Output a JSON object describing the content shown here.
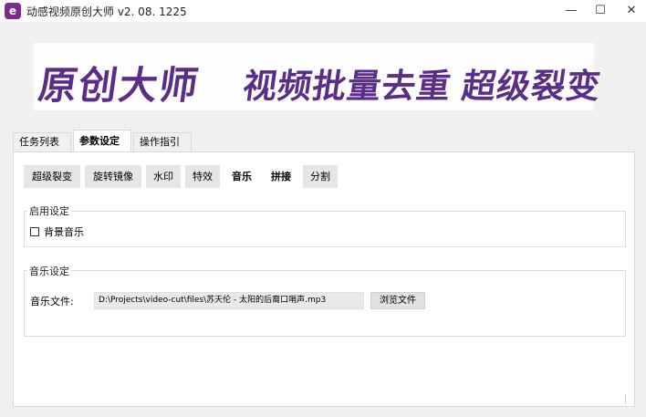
{
  "window": {
    "title": "动感视频原创大师  v2. 08. 1225",
    "icon_letter": "e",
    "minimize": "—",
    "maximize": "☐",
    "close": "✕"
  },
  "banner": {
    "part1": "原创大师",
    "part2": "视频批量去重",
    "part3": "超级裂变",
    "brand_color": "#5a2d86"
  },
  "tabs": [
    "任务列表",
    "参数设定",
    "操作指引"
  ],
  "active_tab": "参数设定",
  "subtabs": [
    "超级裂变",
    "旋转镜像",
    "水印",
    "特效",
    "音乐",
    "拼接",
    "分割"
  ],
  "enable_group": {
    "title": "启用设定",
    "checkbox_label": "背景音乐",
    "checked": false
  },
  "music_group": {
    "title": "音乐设定",
    "file_label": "音乐文件:",
    "file_value": "D:\\Projects\\video-cut\\files\\苏天伦 - 太阳的后裔口哨声.mp3",
    "browse_label": "浏览文件"
  }
}
